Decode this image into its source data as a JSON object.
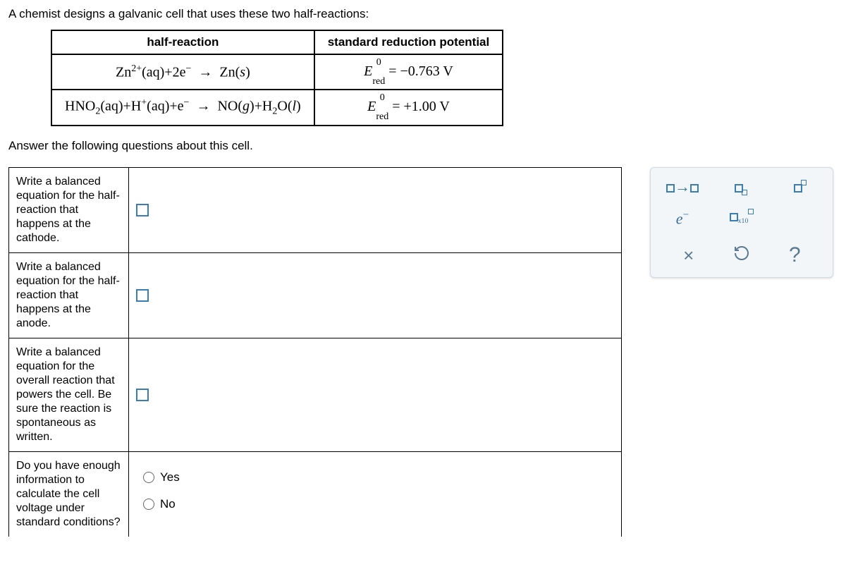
{
  "intro": "A chemist designs a galvanic cell that uses these two half-reactions:",
  "table_headers": {
    "col1": "half-reaction",
    "col2": "standard reduction potential"
  },
  "reactions": [
    {
      "reaction_html": "Zn<sup>2+</sup>(aq)+2e<sup>−</sup> <span class='arrow'>→</span> Zn(s)",
      "potential_prefix": "E",
      "potential_sup": "0",
      "potential_sub": "red",
      "potential_value": "= −0.763 V"
    },
    {
      "reaction_html": "HNO<sub>2</sub>(aq)+H<sup>+</sup>(aq)+e<sup>−</sup> <span class='arrow'>→</span> NO(g)+H<sub>2</sub>O(l)",
      "potential_prefix": "E",
      "potential_sup": "0",
      "potential_sub": "red",
      "potential_value": "= +1.00 V"
    }
  ],
  "followup": "Answer the following questions about this cell.",
  "questions": {
    "q1": "Write a balanced equation for the half-reaction that happens at the cathode.",
    "q2": "Write a balanced equation for the half-reaction that happens at the anode.",
    "q3": "Write a balanced equation for the overall reaction that powers the cell. Be sure the reaction is spontaneous as written.",
    "q4": "Do you have enough information to calculate the cell voltage under standard conditions?"
  },
  "radio": {
    "yes": "Yes",
    "no": "No"
  },
  "tools": {
    "yields": "□→□",
    "subscript": "□□",
    "superscript": "□□",
    "electron": "e⁻",
    "scinot": "□x10□",
    "clear": "×",
    "reset": "↺",
    "help": "?"
  }
}
